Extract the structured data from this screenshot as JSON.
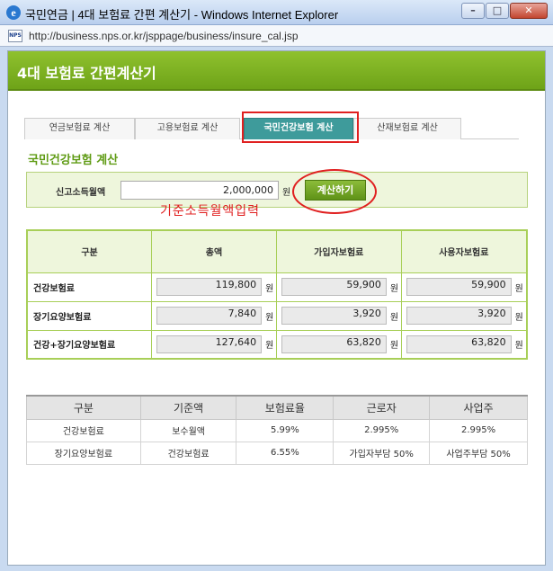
{
  "window": {
    "title": "국민연금 | 4대 보험료 간편 계산기 - Windows Internet Explorer",
    "url": "http://business.nps.or.kr/jsppage/business/insure_cal.jsp",
    "favicon": "NPS"
  },
  "banner": {
    "title": "4대 보험료 간편계산기"
  },
  "tabs": [
    {
      "label": "연금보험료 계산",
      "active": false
    },
    {
      "label": "고용보험료 계산",
      "active": false
    },
    {
      "label": "국민건강보험 계산",
      "active": true
    },
    {
      "label": "산재보험료 계산",
      "active": false
    }
  ],
  "section": {
    "title": "국민건강보험 계산"
  },
  "income": {
    "label": "신고소득월액",
    "value": "2,000,000",
    "unit": "원",
    "button": "계산하기",
    "annotation": "기준소득월액입력"
  },
  "result": {
    "headers": [
      "구분",
      "총액",
      "가입자보험료",
      "사용자보험료"
    ],
    "unit": "원",
    "rows": [
      {
        "label": "건강보험료",
        "total": "119,800",
        "employee": "59,900",
        "employer": "59,900"
      },
      {
        "label": "장기요양보험료",
        "total": "7,840",
        "employee": "3,920",
        "employer": "3,920"
      },
      {
        "label": "건강+장기요양보험료",
        "total": "127,640",
        "employee": "63,820",
        "employer": "63,820"
      }
    ]
  },
  "info": {
    "headers": [
      "구분",
      "기준액",
      "보험료율",
      "근로자",
      "사업주"
    ],
    "rows": [
      [
        "건강보험료",
        "보수월액",
        "5.99%",
        "2.995%",
        "2.995%"
      ],
      [
        "장기요양보험료",
        "건강보험료",
        "6.55%",
        "가입자부담 50%",
        "사업주부담 50%"
      ]
    ]
  },
  "colors": {
    "accent": "#6ea318",
    "active_tab": "#3e9b9b",
    "highlight": "#e02020"
  }
}
